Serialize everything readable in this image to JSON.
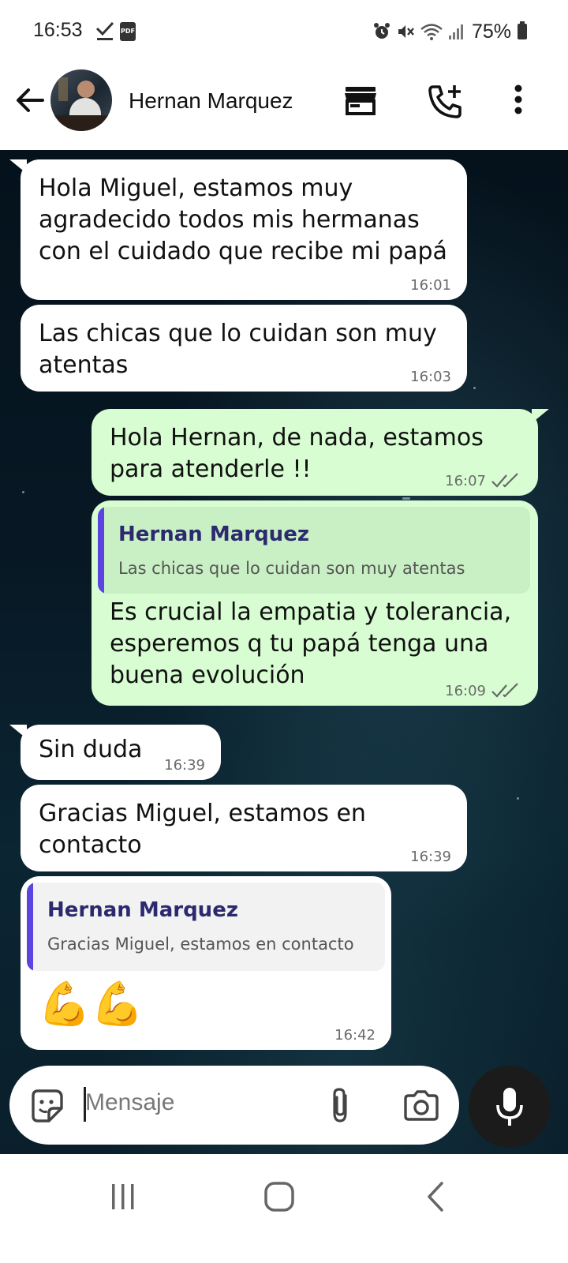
{
  "status_bar": {
    "time": "16:53",
    "battery": "75%"
  },
  "header": {
    "contact_name": "Hernan Marquez"
  },
  "messages": [
    {
      "type": "incoming",
      "lines": [
        "Hola Miguel, estamos muy",
        "agradecido todos mis hermanas",
        "con el cuidado que recibe mi papá"
      ],
      "time": "16:01"
    },
    {
      "type": "incoming",
      "lines": [
        "Las chicas que lo cuidan son muy",
        "atentas"
      ],
      "time": "16:03"
    },
    {
      "type": "outgoing",
      "lines": [
        "Hola Hernan, de nada, estamos",
        "para atenderle !!"
      ],
      "time": "16:07"
    },
    {
      "type": "outgoing",
      "quote": {
        "author": "Hernan Marquez",
        "text": "Las chicas que lo cuidan son muy atentas"
      },
      "lines": [
        "Es crucial la empatia y tolerancia,",
        "esperemos q tu papá tenga una",
        "buena evolución"
      ],
      "time": "16:09"
    },
    {
      "type": "incoming",
      "lines": [
        "Sin duda"
      ],
      "time": "16:39"
    },
    {
      "type": "incoming",
      "lines": [
        "Gracias Miguel, estamos en",
        "contacto"
      ],
      "time": "16:39"
    },
    {
      "type": "incoming",
      "quote": {
        "author": "Hernan Marquez",
        "text": "Gracias Miguel, estamos en contacto"
      },
      "emoji": "💪💪",
      "time": "16:42"
    }
  ],
  "composer": {
    "placeholder": "Mensaje"
  },
  "icons": {
    "back": "arrow-left-icon",
    "catalog": "store-icon",
    "call": "add-call-icon",
    "menu": "more-vert-icon",
    "sticker": "sticker-icon",
    "attach": "paperclip-icon",
    "camera": "camera-icon",
    "mic": "microphone-icon",
    "read_receipt": "double-check-icon"
  },
  "colors": {
    "incoming_bubble": "#ffffff",
    "outgoing_bubble": "#d8fdd2",
    "quote_bar": "#5b45e0",
    "quote_author": "#2c2a6e"
  }
}
